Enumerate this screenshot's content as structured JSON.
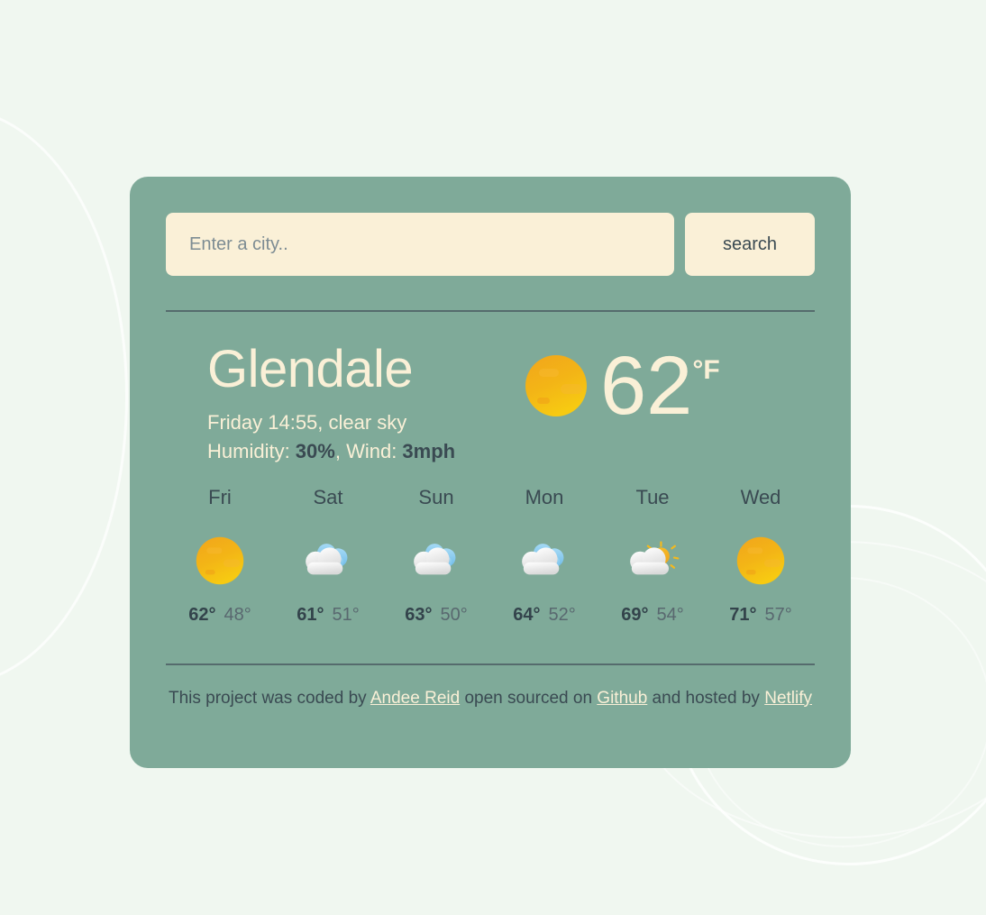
{
  "search": {
    "placeholder": "Enter a city..",
    "value": "",
    "button_label": "search"
  },
  "current": {
    "city": "Glendale",
    "conditions": "Friday 14:55, clear sky",
    "humidity_label": "Humidity: ",
    "humidity_value": "30%",
    "wind_label": ", Wind: ",
    "wind_value": "3mph",
    "temperature": "62",
    "unit": "°F",
    "icon": "sun-icon"
  },
  "forecast": [
    {
      "day": "Fri",
      "icon": "sun-icon",
      "high": "62°",
      "low": "48°"
    },
    {
      "day": "Sat",
      "icon": "cloudy-icon",
      "high": "61°",
      "low": "51°"
    },
    {
      "day": "Sun",
      "icon": "cloudy-icon",
      "high": "63°",
      "low": "50°"
    },
    {
      "day": "Mon",
      "icon": "cloudy-icon",
      "high": "64°",
      "low": "52°"
    },
    {
      "day": "Tue",
      "icon": "partly-cloudy-icon",
      "high": "69°",
      "low": "54°"
    },
    {
      "day": "Wed",
      "icon": "sun-icon",
      "high": "71°",
      "low": "57°"
    }
  ],
  "footer": {
    "part1": "This project was coded by ",
    "author": "Andee Reid",
    "part2": " open sourced on ",
    "source": "Github",
    "part3": " and hosted by ",
    "host": "Netlify"
  },
  "colors": {
    "page_background": "#f0f7f0",
    "card_background": "#7faa99",
    "cream": "#faf0d7",
    "dark_text": "#3a4a52",
    "sun_orange": "#f0a81e",
    "sun_yellow": "#f5c518",
    "cloud_blue": "#8ecbf0",
    "cloud_white": "#f2f2f2"
  }
}
